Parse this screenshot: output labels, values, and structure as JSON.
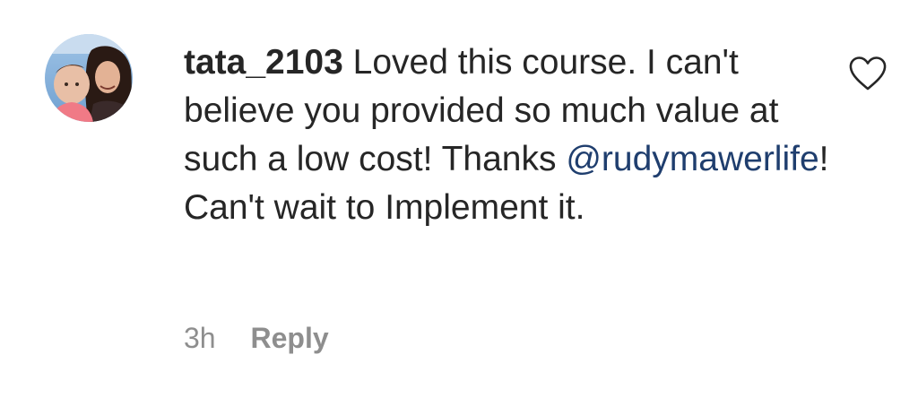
{
  "comment": {
    "username": "tata_2103",
    "text_before_mention": "Loved this course. I can't believe you provided so much value at such a low cost! Thanks ",
    "mention": "@rudymawerlife",
    "text_after_mention": "! Can't wait to Implement it.",
    "timestamp": "3h",
    "reply_label": "Reply",
    "like_icon": "heart-outline-icon",
    "avatar": "user-avatar-photo"
  },
  "colors": {
    "text": "#262626",
    "mention": "#1f3e6e",
    "meta": "#8e8e8e"
  }
}
